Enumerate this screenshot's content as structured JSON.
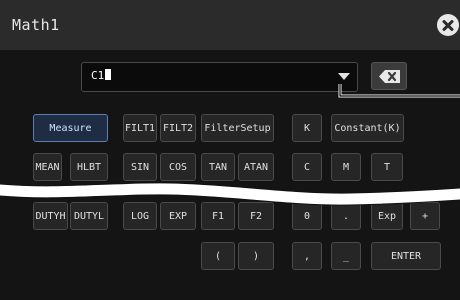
{
  "dialog": {
    "title": "Math1"
  },
  "expression": {
    "value": "C1"
  },
  "keys": {
    "measure": "Measure",
    "filt1": "FILT1",
    "filt2": "FILT2",
    "filtersetup": "FilterSetup",
    "k": "K",
    "constant": "Constant(K)",
    "mean": "MEAN",
    "hlbt": "HLBT",
    "sin": "SIN",
    "cos": "COS",
    "tan": "TAN",
    "atan": "ATAN",
    "c": "C",
    "m": "M",
    "t": "T",
    "dutyh": "DUTYH",
    "dutyl": "DUTYL",
    "log": "LOG",
    "exp": "EXP",
    "f1": "F1",
    "f2": "F2",
    "zero": "0",
    "dot": ".",
    "exp_e": "Exp",
    "plus": "+",
    "lparen": "(",
    "rparen": ")",
    "comma": ",",
    "underscore": "_",
    "enter": "ENTER"
  },
  "icons": [
    "close-icon",
    "chevron-down-icon",
    "backspace-icon"
  ],
  "colors": {
    "panel": "#141414",
    "titlebar": "#2b2b2b",
    "selected_key": "#1e2d44"
  }
}
